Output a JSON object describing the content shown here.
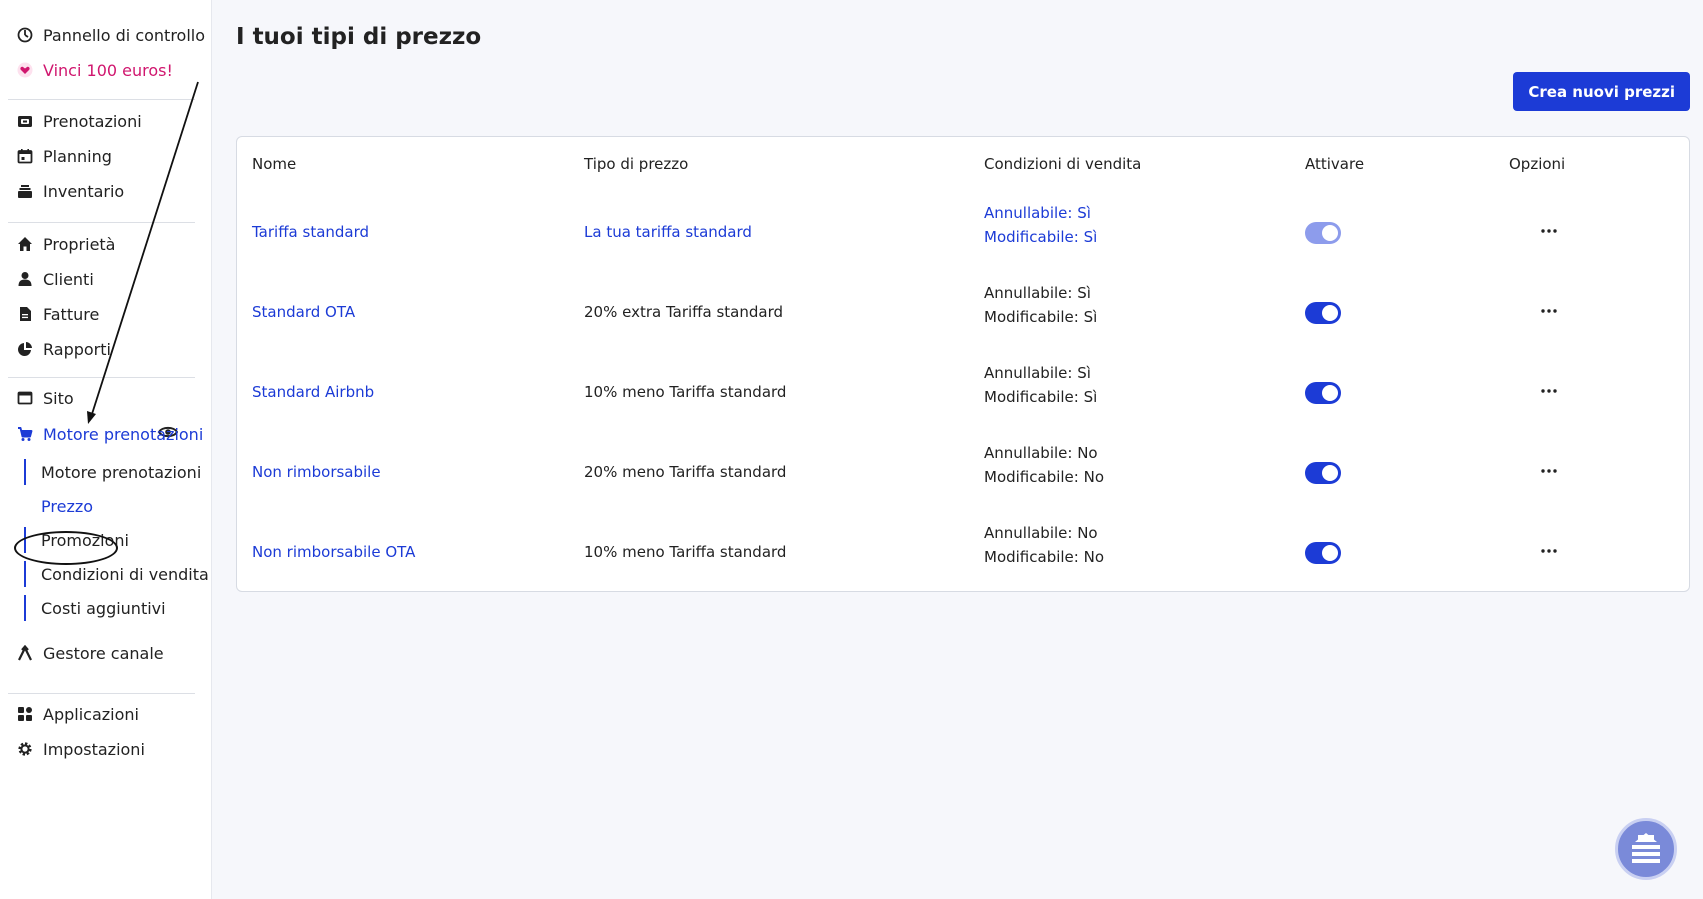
{
  "sidebar": {
    "dashboard": "Pannello di controllo",
    "promo": "Vinci 100 euros!",
    "bookings": "Prenotazioni",
    "planning": "Planning",
    "inventory": "Inventario",
    "property": "Proprietà",
    "clients": "Clienti",
    "invoices": "Fatture",
    "reports": "Rapporti",
    "site": "Sito",
    "booking_engine": "Motore prenotazioni",
    "sub_items": [
      "Motore prenotazioni",
      "Prezzo",
      "Promozioni",
      "Condizioni di vendita",
      "Costi aggiuntivi"
    ],
    "channel_manager": "Gestore canale",
    "applications": "Applicazioni",
    "settings": "Impostazioni"
  },
  "main": {
    "title": "I tuoi tipi di prezzo",
    "create_button": "Crea nuovi prezzi",
    "headers": {
      "name": "Nome",
      "type": "Tipo di prezzo",
      "conditions": "Condizioni di vendita",
      "activate": "Attivare",
      "options": "Opzioni"
    },
    "rows": [
      {
        "name": "Tariffa standard",
        "type": "La tua tariffa standard",
        "cancel": "Annullabile: Sì",
        "modify": "Modificabile: Sì",
        "active": true
      },
      {
        "name": "Standard OTA",
        "type": "20% extra Tariffa standard",
        "cancel": "Annullabile: Sì",
        "modify": "Modificabile: Sì",
        "active": true
      },
      {
        "name": "Standard Airbnb",
        "type": "10% meno Tariffa standard",
        "cancel": "Annullabile: Sì",
        "modify": "Modificabile: Sì",
        "active": true
      },
      {
        "name": "Non rimborsabile",
        "type": "20% meno Tariffa standard",
        "cancel": "Annullabile: No",
        "modify": "Modificabile: No",
        "active": true
      },
      {
        "name": "Non rimborsabile OTA",
        "type": "10% meno Tariffa standard",
        "cancel": "Annullabile: No",
        "modify": "Modificabile: No",
        "active": true
      }
    ]
  },
  "colors": {
    "accent": "#1c3bd6",
    "promo_pink": "#d0166e",
    "toggle_disabled": "#8d9cec"
  },
  "icons": [
    "dashboard-icon",
    "heart-icon",
    "bookings-icon",
    "calendar-icon",
    "inventory-icon",
    "home-icon",
    "users-icon",
    "invoice-icon",
    "pie-chart-icon",
    "window-icon",
    "eye-icon",
    "cart-icon",
    "channel-icon",
    "apps-icon",
    "gear-icon",
    "more-icon",
    "help-widget-icon"
  ]
}
